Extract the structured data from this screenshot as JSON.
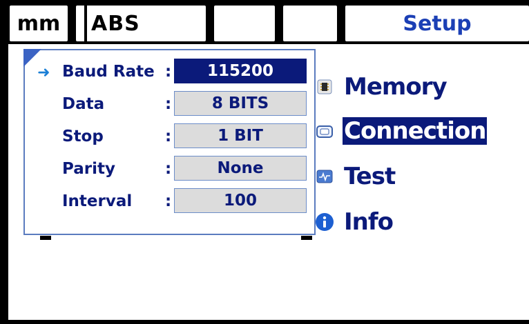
{
  "header": {
    "unit_tab": "mm",
    "mode_tab": "ABS",
    "blank_tab_1": "",
    "blank_tab_2": "",
    "setup_tab": "Setup"
  },
  "menu": {
    "items": [
      {
        "label": "Memory",
        "icon": "memory-chip-icon",
        "selected": false
      },
      {
        "label": "Connection",
        "icon": "connection-icon",
        "selected": true
      },
      {
        "label": "Test",
        "icon": "test-monitor-icon",
        "selected": false
      },
      {
        "label": "Info",
        "icon": "info-icon",
        "selected": false
      }
    ]
  },
  "connection_dialog": {
    "rows": [
      {
        "label": "Baud Rate",
        "value": "115200",
        "active": true
      },
      {
        "label": "Data",
        "value": "8 BITS",
        "active": false
      },
      {
        "label": "Stop",
        "value": "1 BIT",
        "active": false
      },
      {
        "label": "Parity",
        "value": "None",
        "active": false
      },
      {
        "label": "Interval",
        "value": "100",
        "active": false
      }
    ],
    "colon": ":"
  },
  "colors": {
    "accent": "#0b1a7a",
    "setup_text": "#1b3fb5",
    "field_bg": "#dcdcdc",
    "frame": "#000000"
  }
}
